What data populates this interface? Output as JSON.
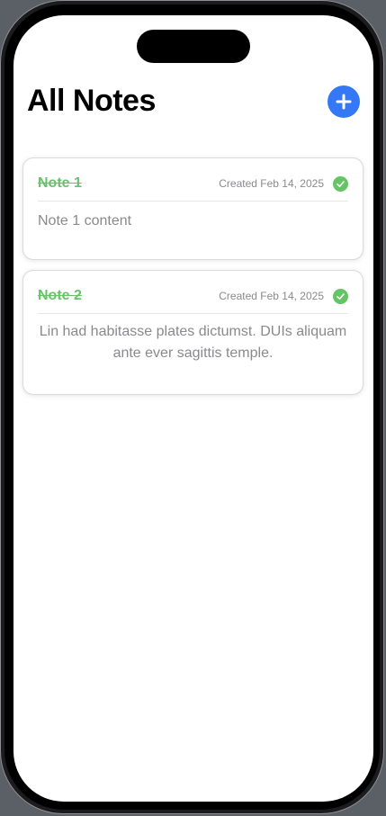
{
  "header": {
    "title": "All Notes",
    "add_icon": "plus-icon"
  },
  "notes": [
    {
      "title": "Note 1",
      "created": "Created Feb 14, 2025",
      "content": "Note 1 content",
      "completed": true,
      "status_icon": "checkmark-circle-icon"
    },
    {
      "title": "Note 2",
      "created": "Created Feb 14, 2025",
      "content": "Lin had habitasse plates dictumst. DUIs aliquam ante ever sagittis temple.",
      "completed": true,
      "status_icon": "checkmark-circle-icon"
    }
  ],
  "colors": {
    "accent": "#3478f6",
    "completed": "#65c466",
    "secondary_text": "#8a8a8e"
  }
}
